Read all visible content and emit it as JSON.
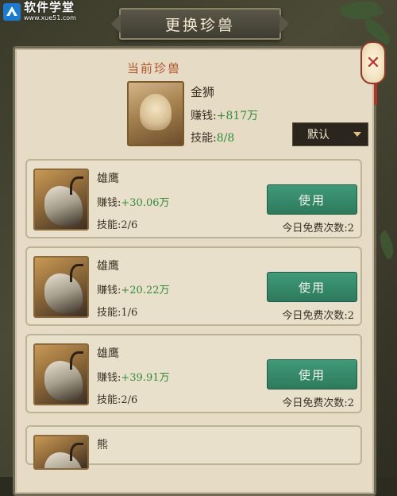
{
  "watermark": {
    "title": "软件学堂",
    "url": "www.xue51.com"
  },
  "dialog": {
    "title": "更换珍兽"
  },
  "current_pet": {
    "section_label": "当前珍兽",
    "name": "金狮",
    "earn_label": "赚钱:",
    "earn_value": "+817万",
    "skill_label": "技能:",
    "skill_value": "8/8"
  },
  "sort_dropdown": {
    "value": "默认"
  },
  "pets": [
    {
      "name": "雄鹰",
      "earn_label": "赚钱:",
      "earn_value": "+30.06万",
      "skill": "技能:2/6",
      "button": "使用",
      "free_count": "今日免费次数:2"
    },
    {
      "name": "雄鹰",
      "earn_label": "赚钱:",
      "earn_value": "+20.22万",
      "skill": "技能:1/6",
      "button": "使用",
      "free_count": "今日免费次数:2"
    },
    {
      "name": "雄鹰",
      "earn_label": "赚钱:",
      "earn_value": "+39.91万",
      "skill": "技能:2/6",
      "button": "使用",
      "free_count": "今日免费次数:2"
    },
    {
      "name": "熊"
    }
  ],
  "colors": {
    "accent_green": "#2f8a3a",
    "button_green": "#2d7a5c",
    "label_orange": "#b0552a",
    "close_red": "#c02a2a"
  }
}
